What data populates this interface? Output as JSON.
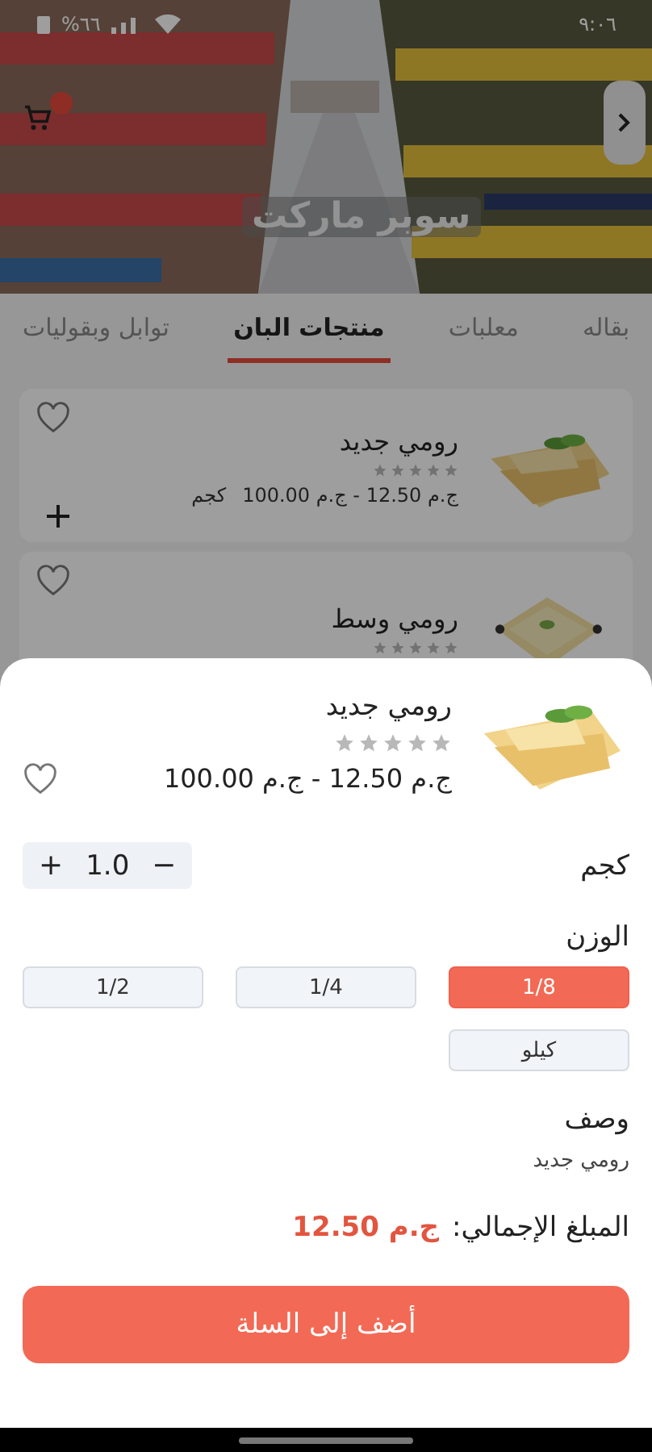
{
  "status_bar": {
    "time": "٩:٠٦",
    "battery": "%٦٦"
  },
  "store": {
    "title": "سوبر ماركت"
  },
  "tabs": [
    {
      "label": "بقاله",
      "selected": false
    },
    {
      "label": "معلبات",
      "selected": false
    },
    {
      "label": "منتجات البان",
      "selected": true
    },
    {
      "label": "توابل وبقوليات",
      "selected": false
    }
  ],
  "products": [
    {
      "name": "رومي جديد",
      "stars": 0,
      "price": "ج.م 12.50 - ج.م 100.00",
      "unit": "كجم",
      "favorite": false
    },
    {
      "name": "رومي وسط",
      "stars": 0,
      "favorite": false
    }
  ],
  "sheet": {
    "name": "رومي جديد",
    "stars": 0,
    "price": "ج.م 12.50 - ج.م 100.00",
    "favorite": false,
    "unit": "كجم",
    "quantity": "1.0",
    "minus": "−",
    "plus": "+",
    "weight_label": "الوزن",
    "weights": [
      {
        "label": "1/8",
        "selected": true
      },
      {
        "label": "1/4",
        "selected": false
      },
      {
        "label": "1/2",
        "selected": false
      },
      {
        "label": "كيلو",
        "selected": false
      }
    ],
    "description_label": "وصف",
    "description": "رومي جديد",
    "total_label": "المبلغ الإجمالي:",
    "total": "ج.م 12.50",
    "button": "أضف إلى السلة"
  }
}
